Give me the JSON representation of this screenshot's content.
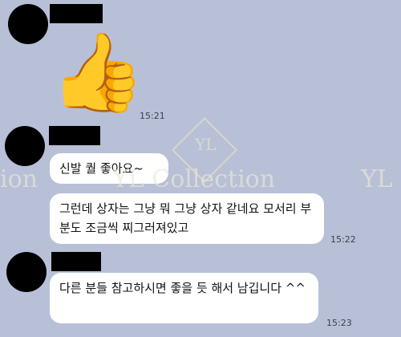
{
  "messages": [
    {
      "type": "emoji",
      "emoji": "👍",
      "time": "15:21"
    },
    {
      "type": "text",
      "bubbles": [
        "신발 퀄 좋아요~",
        "그런데 상자는 그냥 뭐 그냥 상자 같네요 모서리 부분도 조금씩 찌그러져있고"
      ],
      "time": "15:22"
    },
    {
      "type": "text",
      "bubbles": [
        "다른 분들 참고하시면 좋을 듯 해서 남깁니다 ^^"
      ],
      "time": "15:23"
    }
  ],
  "watermark": {
    "text": "YL Collection",
    "left_fragment": "ion",
    "right_fragment": "YL",
    "logo_letter": "YL"
  },
  "icons": {
    "thumbs_up": "thumbs-up-icon"
  }
}
